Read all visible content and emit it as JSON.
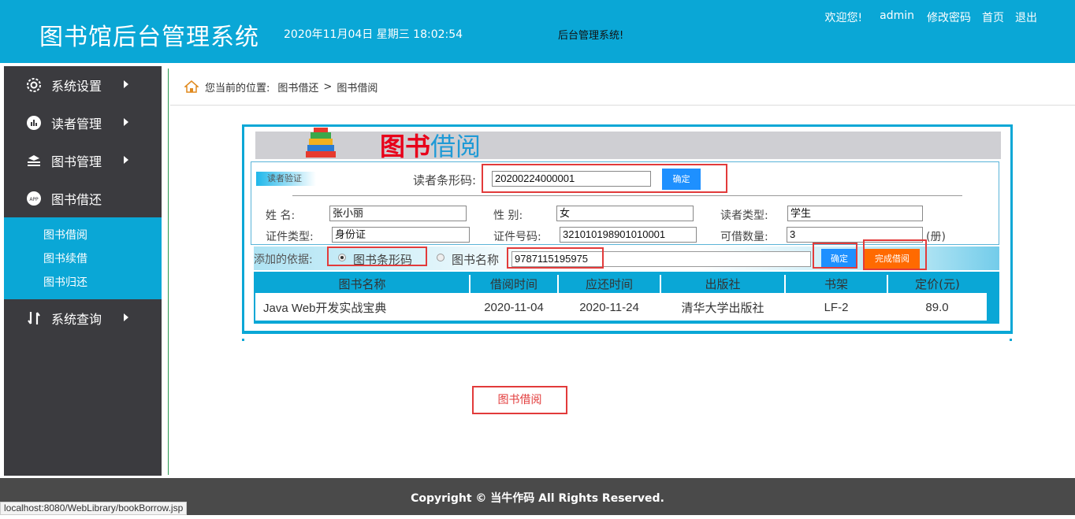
{
  "header": {
    "title": "图书馆后台管理系统",
    "datetime": "2020年11月04日 星期三 18:02:54",
    "message": "后台管理系统!",
    "welcome": "欢迎您!",
    "user": "admin",
    "change_password": "修改密码",
    "home": "首页",
    "logout": "退出"
  },
  "sidebar": {
    "items": [
      {
        "label": "系统设置",
        "icon": "gear-icon"
      },
      {
        "label": "读者管理",
        "icon": "chart-icon"
      },
      {
        "label": "图书管理",
        "icon": "stack-icon"
      },
      {
        "label": "图书借还",
        "icon": "app-icon"
      }
    ],
    "sub_items": [
      {
        "label": "图书借阅"
      },
      {
        "label": "图书续借"
      },
      {
        "label": "图书归还"
      }
    ],
    "last_item": {
      "label": "系统查询",
      "icon": "sort-icon"
    }
  },
  "breadcrumb": {
    "prefix": "您当前的位置:",
    "parent": "图书借还",
    "separator": ">",
    "current": "图书借阅"
  },
  "panel": {
    "banner_red": "图书",
    "banner_blue": "借阅",
    "reader_tag": "读者验证",
    "barcode_label": "读者条形码:",
    "barcode_value": "20200224000001",
    "confirm_label": "确定",
    "fields": {
      "name_label": "姓    名:",
      "name_value": "张小丽",
      "gender_label": "性    别:",
      "gender_value": "女",
      "type_label": "读者类型:",
      "type_value": "学生",
      "id_type_label": "证件类型:",
      "id_type_value": "身份证",
      "id_no_label": "证件号码:",
      "id_no_value": "321010198901010001",
      "quota_label": "可借数量:",
      "quota_value": "3",
      "quota_unit": "(册)"
    },
    "add_by_label": "添加的依据:",
    "radio_barcode": "图书条形码",
    "radio_name": "图书名称",
    "book_input_value": "9787115195975",
    "confirm2_label": "确定",
    "finish_label": "完成借阅",
    "table": {
      "headers": [
        "图书名称",
        "借阅时间",
        "应还时间",
        "出版社",
        "书架",
        "定价(元)"
      ],
      "rows": [
        [
          "Java Web开发实战宝典",
          "2020-11-04",
          "2020-11-24",
          "清华大学出版社",
          "LF-2",
          "89.0"
        ]
      ]
    }
  },
  "callout": "图书借阅",
  "footer": "Copyright © 当牛作码 All Rights Reserved.",
  "status_url": "localhost:8080/WebLibrary/bookBorrow.jsp",
  "colors": {
    "header_bg": "#0aa7d6",
    "sidebar_bg": "#3b3b3f",
    "accent_blue": "#1e90ff",
    "accent_orange": "#ff6a00",
    "annotation_red": "#e23b3b"
  }
}
